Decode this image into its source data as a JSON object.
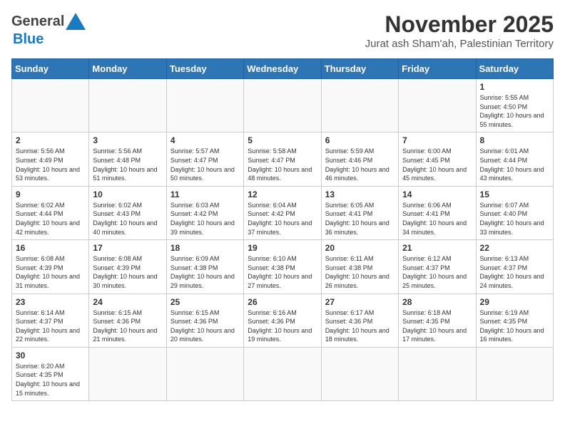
{
  "header": {
    "logo_line1": "General",
    "logo_line2": "Blue",
    "title": "November 2025",
    "subtitle": "Jurat ash Sham'ah, Palestinian Territory"
  },
  "weekdays": [
    "Sunday",
    "Monday",
    "Tuesday",
    "Wednesday",
    "Thursday",
    "Friday",
    "Saturday"
  ],
  "weeks": [
    [
      {
        "day": "",
        "info": ""
      },
      {
        "day": "",
        "info": ""
      },
      {
        "day": "",
        "info": ""
      },
      {
        "day": "",
        "info": ""
      },
      {
        "day": "",
        "info": ""
      },
      {
        "day": "",
        "info": ""
      },
      {
        "day": "1",
        "info": "Sunrise: 5:55 AM\nSunset: 4:50 PM\nDaylight: 10 hours\nand 55 minutes."
      }
    ],
    [
      {
        "day": "2",
        "info": "Sunrise: 5:56 AM\nSunset: 4:49 PM\nDaylight: 10 hours\nand 53 minutes."
      },
      {
        "day": "3",
        "info": "Sunrise: 5:56 AM\nSunset: 4:48 PM\nDaylight: 10 hours\nand 51 minutes."
      },
      {
        "day": "4",
        "info": "Sunrise: 5:57 AM\nSunset: 4:47 PM\nDaylight: 10 hours\nand 50 minutes."
      },
      {
        "day": "5",
        "info": "Sunrise: 5:58 AM\nSunset: 4:47 PM\nDaylight: 10 hours\nand 48 minutes."
      },
      {
        "day": "6",
        "info": "Sunrise: 5:59 AM\nSunset: 4:46 PM\nDaylight: 10 hours\nand 46 minutes."
      },
      {
        "day": "7",
        "info": "Sunrise: 6:00 AM\nSunset: 4:45 PM\nDaylight: 10 hours\nand 45 minutes."
      },
      {
        "day": "8",
        "info": "Sunrise: 6:01 AM\nSunset: 4:44 PM\nDaylight: 10 hours\nand 43 minutes."
      }
    ],
    [
      {
        "day": "9",
        "info": "Sunrise: 6:02 AM\nSunset: 4:44 PM\nDaylight: 10 hours\nand 42 minutes."
      },
      {
        "day": "10",
        "info": "Sunrise: 6:02 AM\nSunset: 4:43 PM\nDaylight: 10 hours\nand 40 minutes."
      },
      {
        "day": "11",
        "info": "Sunrise: 6:03 AM\nSunset: 4:42 PM\nDaylight: 10 hours\nand 39 minutes."
      },
      {
        "day": "12",
        "info": "Sunrise: 6:04 AM\nSunset: 4:42 PM\nDaylight: 10 hours\nand 37 minutes."
      },
      {
        "day": "13",
        "info": "Sunrise: 6:05 AM\nSunset: 4:41 PM\nDaylight: 10 hours\nand 36 minutes."
      },
      {
        "day": "14",
        "info": "Sunrise: 6:06 AM\nSunset: 4:41 PM\nDaylight: 10 hours\nand 34 minutes."
      },
      {
        "day": "15",
        "info": "Sunrise: 6:07 AM\nSunset: 4:40 PM\nDaylight: 10 hours\nand 33 minutes."
      }
    ],
    [
      {
        "day": "16",
        "info": "Sunrise: 6:08 AM\nSunset: 4:39 PM\nDaylight: 10 hours\nand 31 minutes."
      },
      {
        "day": "17",
        "info": "Sunrise: 6:08 AM\nSunset: 4:39 PM\nDaylight: 10 hours\nand 30 minutes."
      },
      {
        "day": "18",
        "info": "Sunrise: 6:09 AM\nSunset: 4:38 PM\nDaylight: 10 hours\nand 29 minutes."
      },
      {
        "day": "19",
        "info": "Sunrise: 6:10 AM\nSunset: 4:38 PM\nDaylight: 10 hours\nand 27 minutes."
      },
      {
        "day": "20",
        "info": "Sunrise: 6:11 AM\nSunset: 4:38 PM\nDaylight: 10 hours\nand 26 minutes."
      },
      {
        "day": "21",
        "info": "Sunrise: 6:12 AM\nSunset: 4:37 PM\nDaylight: 10 hours\nand 25 minutes."
      },
      {
        "day": "22",
        "info": "Sunrise: 6:13 AM\nSunset: 4:37 PM\nDaylight: 10 hours\nand 24 minutes."
      }
    ],
    [
      {
        "day": "23",
        "info": "Sunrise: 6:14 AM\nSunset: 4:37 PM\nDaylight: 10 hours\nand 22 minutes."
      },
      {
        "day": "24",
        "info": "Sunrise: 6:15 AM\nSunset: 4:36 PM\nDaylight: 10 hours\nand 21 minutes."
      },
      {
        "day": "25",
        "info": "Sunrise: 6:15 AM\nSunset: 4:36 PM\nDaylight: 10 hours\nand 20 minutes."
      },
      {
        "day": "26",
        "info": "Sunrise: 6:16 AM\nSunset: 4:36 PM\nDaylight: 10 hours\nand 19 minutes."
      },
      {
        "day": "27",
        "info": "Sunrise: 6:17 AM\nSunset: 4:36 PM\nDaylight: 10 hours\nand 18 minutes."
      },
      {
        "day": "28",
        "info": "Sunrise: 6:18 AM\nSunset: 4:35 PM\nDaylight: 10 hours\nand 17 minutes."
      },
      {
        "day": "29",
        "info": "Sunrise: 6:19 AM\nSunset: 4:35 PM\nDaylight: 10 hours\nand 16 minutes."
      }
    ],
    [
      {
        "day": "30",
        "info": "Sunrise: 6:20 AM\nSunset: 4:35 PM\nDaylight: 10 hours\nand 15 minutes."
      },
      {
        "day": "",
        "info": ""
      },
      {
        "day": "",
        "info": ""
      },
      {
        "day": "",
        "info": ""
      },
      {
        "day": "",
        "info": ""
      },
      {
        "day": "",
        "info": ""
      },
      {
        "day": "",
        "info": ""
      }
    ]
  ]
}
